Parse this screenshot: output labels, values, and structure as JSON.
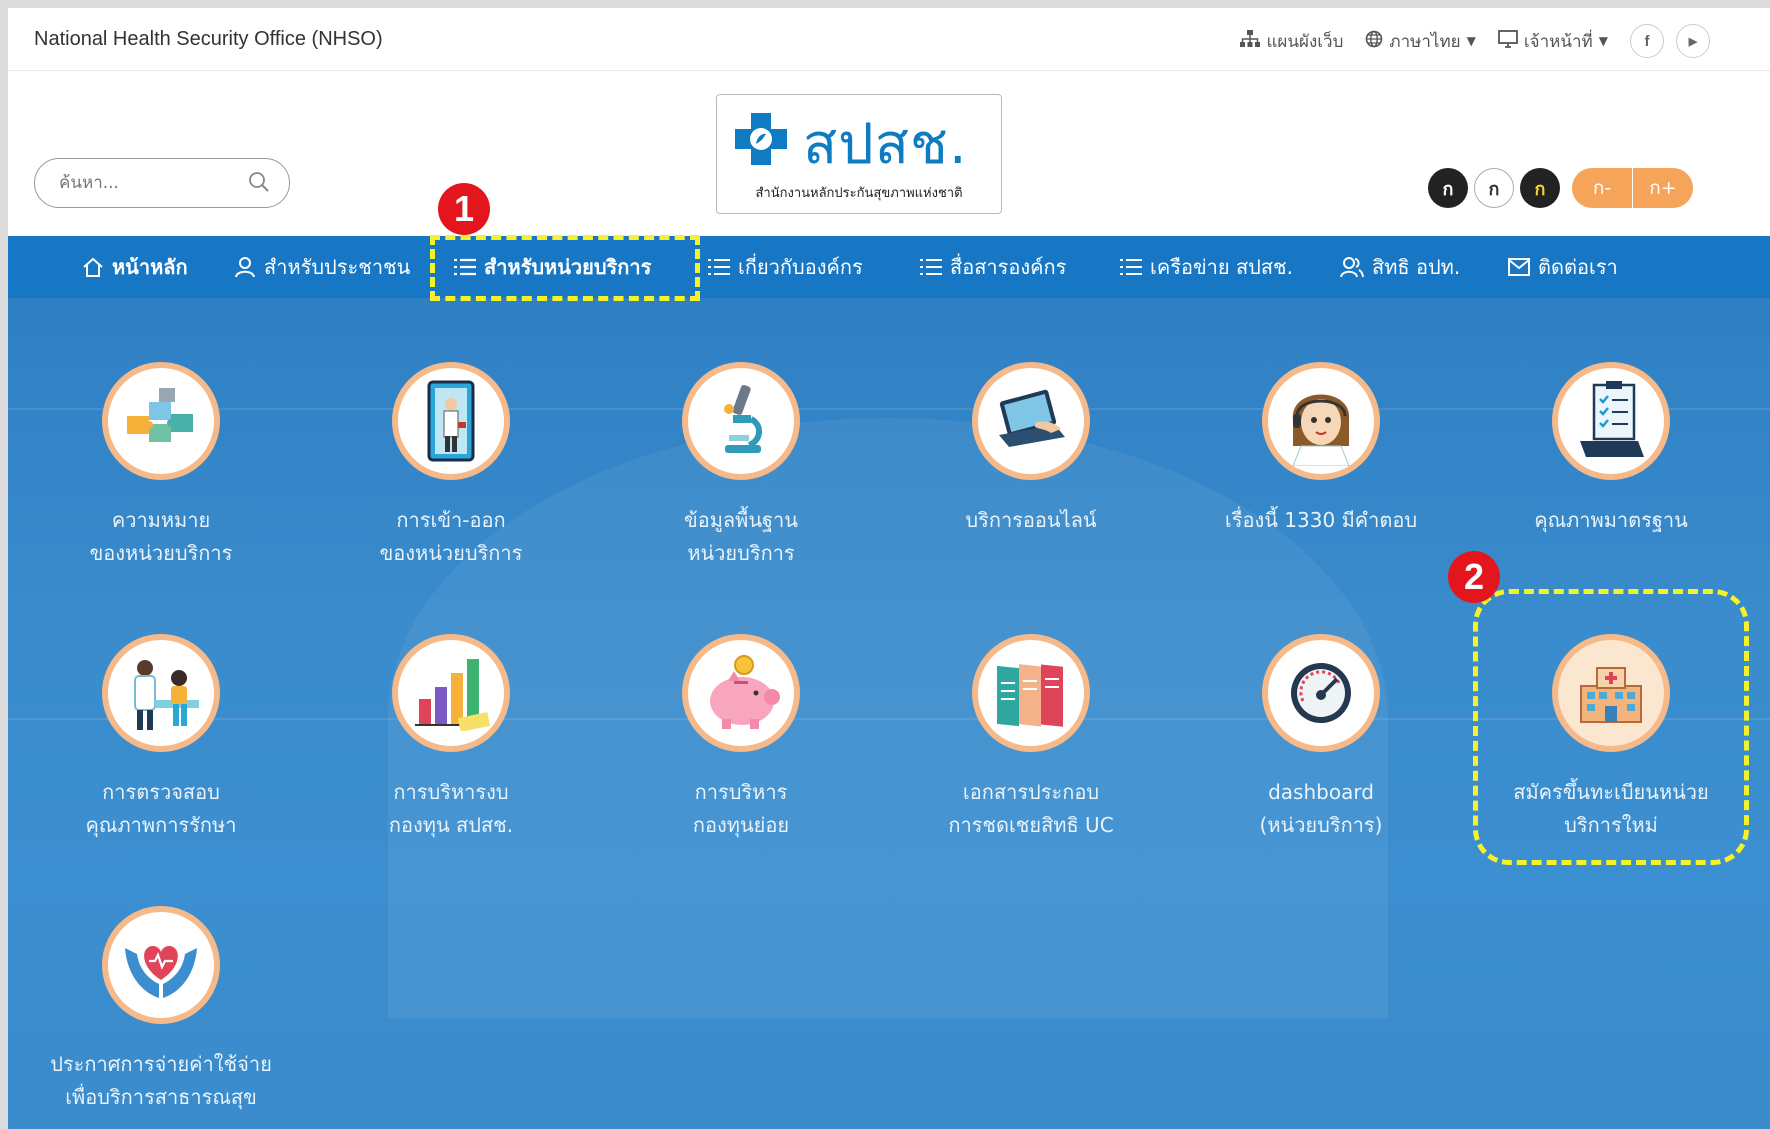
{
  "topbar": {
    "org_name": "National Health Security Office (NHSO)",
    "sitemap": "แผนผังเว็บ",
    "language": "ภาษาไทย",
    "staff": "เจ้าหน้าที่",
    "facebook": "f",
    "youtube": "▶"
  },
  "header": {
    "search_placeholder": "ค้นหา...",
    "logo_abbr": "สปสช.",
    "logo_full": "สำนักงานหลักประกันสุขภาพแห่งชาติ",
    "font_controls": [
      "ก",
      "ก",
      "ก"
    ],
    "font_minus": "ก-",
    "font_plus": "ก+"
  },
  "nav": [
    {
      "label": "หน้าหลัก"
    },
    {
      "label": "สำหรับประชาชน"
    },
    {
      "label": "สำหรับหน่วยบริการ"
    },
    {
      "label": "เกี่ยวกับองค์กร"
    },
    {
      "label": "สื่อสารองค์กร"
    },
    {
      "label": "เครือข่าย สปสช."
    },
    {
      "label": "สิทธิ อปท."
    },
    {
      "label": "ติดต่อเรา"
    }
  ],
  "tiles": [
    {
      "line1": "ความหมาย",
      "line2": "ของหน่วยบริการ",
      "icon": "puzzle-icon"
    },
    {
      "line1": "การเข้า-ออก",
      "line2": "ของหน่วยบริการ",
      "icon": "door-icon"
    },
    {
      "line1": "ข้อมูลพื้นฐาน",
      "line2": "หน่วยบริการ",
      "icon": "microscope-icon"
    },
    {
      "line1": "บริการออนไลน์",
      "line2": "",
      "icon": "laptop-icon"
    },
    {
      "line1": "เรื่องนี้ 1330 มีคำตอบ",
      "line2": "",
      "icon": "operator-icon"
    },
    {
      "line1": "คุณภาพมาตรฐาน",
      "line2": "",
      "icon": "checklist-icon"
    },
    {
      "line1": "การตรวจสอบ",
      "line2": "คุณภาพการรักษา",
      "icon": "doctor-icon"
    },
    {
      "line1": "การบริหารงบ",
      "line2": "กองทุน สปสช.",
      "icon": "barchart-icon"
    },
    {
      "line1": "การบริหาร",
      "line2": "กองทุนย่อย",
      "icon": "piggybank-icon"
    },
    {
      "line1": "เอกสารประกอบ",
      "line2": "การชดเชยสิทธิ UC",
      "icon": "documents-icon"
    },
    {
      "line1": "dashboard",
      "line2": "(หน่วยบริการ)",
      "icon": "gauge-icon"
    },
    {
      "line1": "สมัครขึ้นทะเบียนหน่วย",
      "line2": "บริการใหม่",
      "icon": "hospital-icon"
    },
    {
      "line1": "ประกาศการจ่ายค่าใช้จ่าย",
      "line2": "เพื่อบริการสาธารณสุข",
      "icon": "heart-hands-icon"
    }
  ],
  "annotations": [
    "1",
    "2"
  ],
  "colors": {
    "nav": "#1777c4",
    "annotation_box": "#f6f22a",
    "annotation_badge": "#e4161d",
    "tile_ring": "#f5b98a"
  }
}
